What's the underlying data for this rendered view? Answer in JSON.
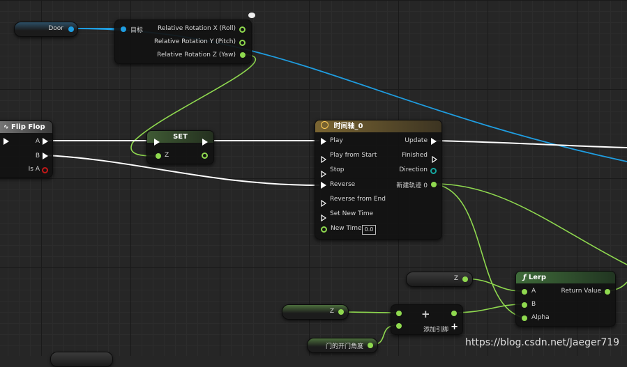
{
  "door_node": {
    "label": "Door"
  },
  "rotation_node": {
    "target_label": "目标",
    "out_x": "Relative Rotation X (Roll)",
    "out_y": "Relative Rotation Y (Pitch)",
    "out_z": "Relative Rotation Z (Yaw)"
  },
  "flipflop_node": {
    "title": "Flip Flop",
    "a": "A",
    "b": "B",
    "is_a": "Is A"
  },
  "set_node": {
    "title": "SET",
    "z": "Z"
  },
  "timeline_node": {
    "title": "时间轴_0",
    "inputs": [
      "Play",
      "Play from Start",
      "Stop",
      "Reverse",
      "Reverse from End",
      "Set New Time",
      "New Time"
    ],
    "new_time_value": "0.0",
    "outputs": {
      "update": "Update",
      "finished": "Finished",
      "direction": "Direction",
      "track": "新建轨迹 0"
    }
  },
  "lerp_node": {
    "title": "Lerp",
    "a": "A",
    "b": "B",
    "alpha": "Alpha",
    "return": "Return Value"
  },
  "z_var_1": {
    "label": "Z"
  },
  "z_var_2": {
    "label": "Z"
  },
  "add_node": {
    "add_pin": "添加引脚"
  },
  "door_angle_var": {
    "label": "门的开门角度"
  },
  "watermark": "https://blog.csdn.net/Jaeger719",
  "colors": {
    "exec": "#ffffff",
    "float": "#8fd94f",
    "object": "#1f9de0",
    "bool": "#c21818",
    "enum": "#15a7a0"
  }
}
